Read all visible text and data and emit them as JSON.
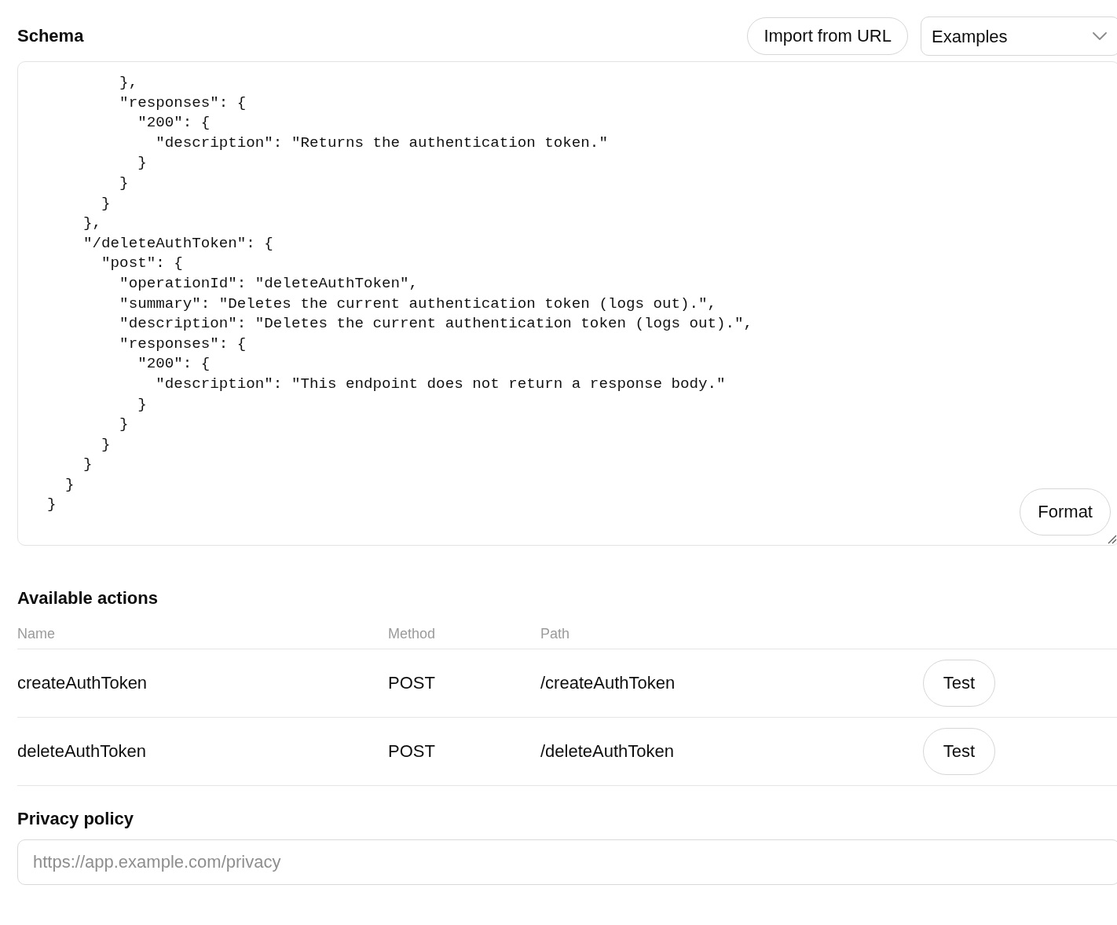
{
  "schema": {
    "title": "Schema",
    "import_button": "Import from URL",
    "examples_dropdown": {
      "value": "Examples"
    },
    "code_lines": [
      "        },",
      "        \"responses\": {",
      "          \"200\": {",
      "            \"description\": \"Returns the authentication token.\"",
      "          }",
      "        }",
      "      }",
      "    },",
      "    \"/deleteAuthToken\": {",
      "      \"post\": {",
      "        \"operationId\": \"deleteAuthToken\",",
      "        \"summary\": \"Deletes the current authentication token (logs out).\",",
      "        \"description\": \"Deletes the current authentication token (logs out).\",",
      "        \"responses\": {",
      "          \"200\": {",
      "            \"description\": \"This endpoint does not return a response body.\"",
      "          }",
      "        }",
      "      }",
      "    }",
      "  }",
      "}"
    ],
    "format_button": "Format"
  },
  "actions": {
    "title": "Available actions",
    "columns": [
      "Name",
      "Method",
      "Path"
    ],
    "rows": [
      {
        "name": "createAuthToken",
        "method": "POST",
        "path": "/createAuthToken",
        "button": "Test"
      },
      {
        "name": "deleteAuthToken",
        "method": "POST",
        "path": "/deleteAuthToken",
        "button": "Test"
      }
    ]
  },
  "privacy_policy": {
    "label": "Privacy policy",
    "placeholder": "https://app.example.com/privacy"
  }
}
